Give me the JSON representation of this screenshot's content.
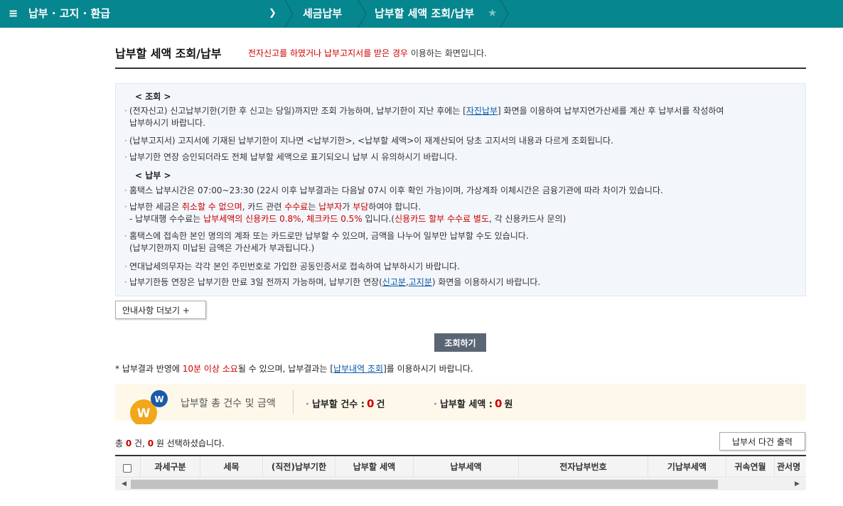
{
  "topbar": {
    "menu_icon": "≡",
    "crumb1": "납부 · 고지 · 환급",
    "crumb2": "세금납부",
    "crumb3": "납부할 세액 조회/납부",
    "star_icon": "★",
    "chevron_icon": "❯"
  },
  "header": {
    "title": "납부할 세액 조회/납부",
    "desc_red": "전자신고를 하였거나 납부고지서를 받은 경우",
    "desc_rest": " 이용하는 화면입니다."
  },
  "info": {
    "section1": "< 조회 >",
    "b1_pre": "(전자신고) 신고납부기한(기한 후 신고는 당일)까지만 조회 가능하며, 납부기한이 지난 후에는 [",
    "b1_link": "자진납부",
    "b1_post": "] 화면을 이용하여 납부지연가산세를 계산 후 납부서를 작성하여",
    "b1_line2": "납부하시기 바랍니다.",
    "b2": "(납부고지서) 고지서에 기재된 납부기한이 지나면 <납부기한>, <납부할 세액>이 재계산되어 당초 고지서의 내용과 다르게 조회됩니다.",
    "b3": "납부기한 연장 승인되더라도 전체 납부할 세액으로 표기되오니 납부 시 유의하시기 바랍니다.",
    "section2": "< 납부 >",
    "b4": "홈택스 납부시간은 07:00~23:30 (22시 이후 납부결과는 다음날 07시 이후 확인 가능)이며, 가상계좌 이체시간은 금융기관에 따라 차이가 있습니다.",
    "b5_a": "납부한 세금은 ",
    "b5_b": "취소할 수 없으며",
    "b5_c": ", 카드 관련 ",
    "b5_d": "수수료",
    "b5_e": "는 ",
    "b5_f": "납부자",
    "b5_g": "가 ",
    "b5_h": "부담",
    "b5_i": "하여야 합니다.",
    "b5_l2_a": "- 납부대행 수수료는 ",
    "b5_l2_b": "납부세액의 신용카드 0.8%, 체크카드 0.5%",
    "b5_l2_c": " 입니다.(",
    "b5_l2_d": "신용카드 할부 수수료 별도",
    "b5_l2_e": ", 각 신용카드사 문의)",
    "b6": "홈택스에 접속한 본인 명의의 계좌 또는 카드로만 납부할 수 있으며, 금액을 나누어 일부만 납부할 수도 있습니다.",
    "b6_line2": "(납부기한까지 미납된 금액은 가산세가 부과됩니다.)",
    "b7": "연대납세의무자는 각각 본인 주민번호로 가입한 공동인증서로 접속하여 납부하시기 바랍니다.",
    "b8_pre": "납부기한등 연장은 납부기한 만료 3일 전까지 가능하며, 납부기한 연장(",
    "b8_link1": "신고분",
    "b8_mid": ",",
    "b8_link2": "고지분",
    "b8_post": ") 화면을 이용하시기 바랍니다."
  },
  "buttons": {
    "more": "안내사항 더보기 +",
    "search": "조회하기",
    "print": "납부서 다건 출력"
  },
  "note": {
    "a": "* 납부결과 반영에 ",
    "b": "10분 이상 소요",
    "c": "될 수 있으며, 납부결과는 [",
    "link": "납부내역 조회",
    "d": "]를 이용하시기 바랍니다."
  },
  "summary": {
    "label": "납부할 총 건수 및 금액",
    "count_label": "납부할 건수 :",
    "count_value": "0",
    "count_unit": "건",
    "amount_label": "납부할 세액 :",
    "amount_value": "0",
    "amount_unit": "원",
    "logo_letters": [
      "W",
      "W"
    ]
  },
  "selection": {
    "a": "총 ",
    "count": "0",
    "b": " 건, ",
    "amount": "0",
    "c": " 원 선택하셨습니다."
  },
  "table": {
    "columns": [
      "과세구분",
      "세목",
      "(직전)납부기한",
      "납부할 세액",
      "납부세액",
      "전자납부번호",
      "기납부세액",
      "귀속연월",
      "관서명"
    ]
  },
  "scroll": {
    "left_icon": "◀",
    "right_icon": "▶"
  }
}
